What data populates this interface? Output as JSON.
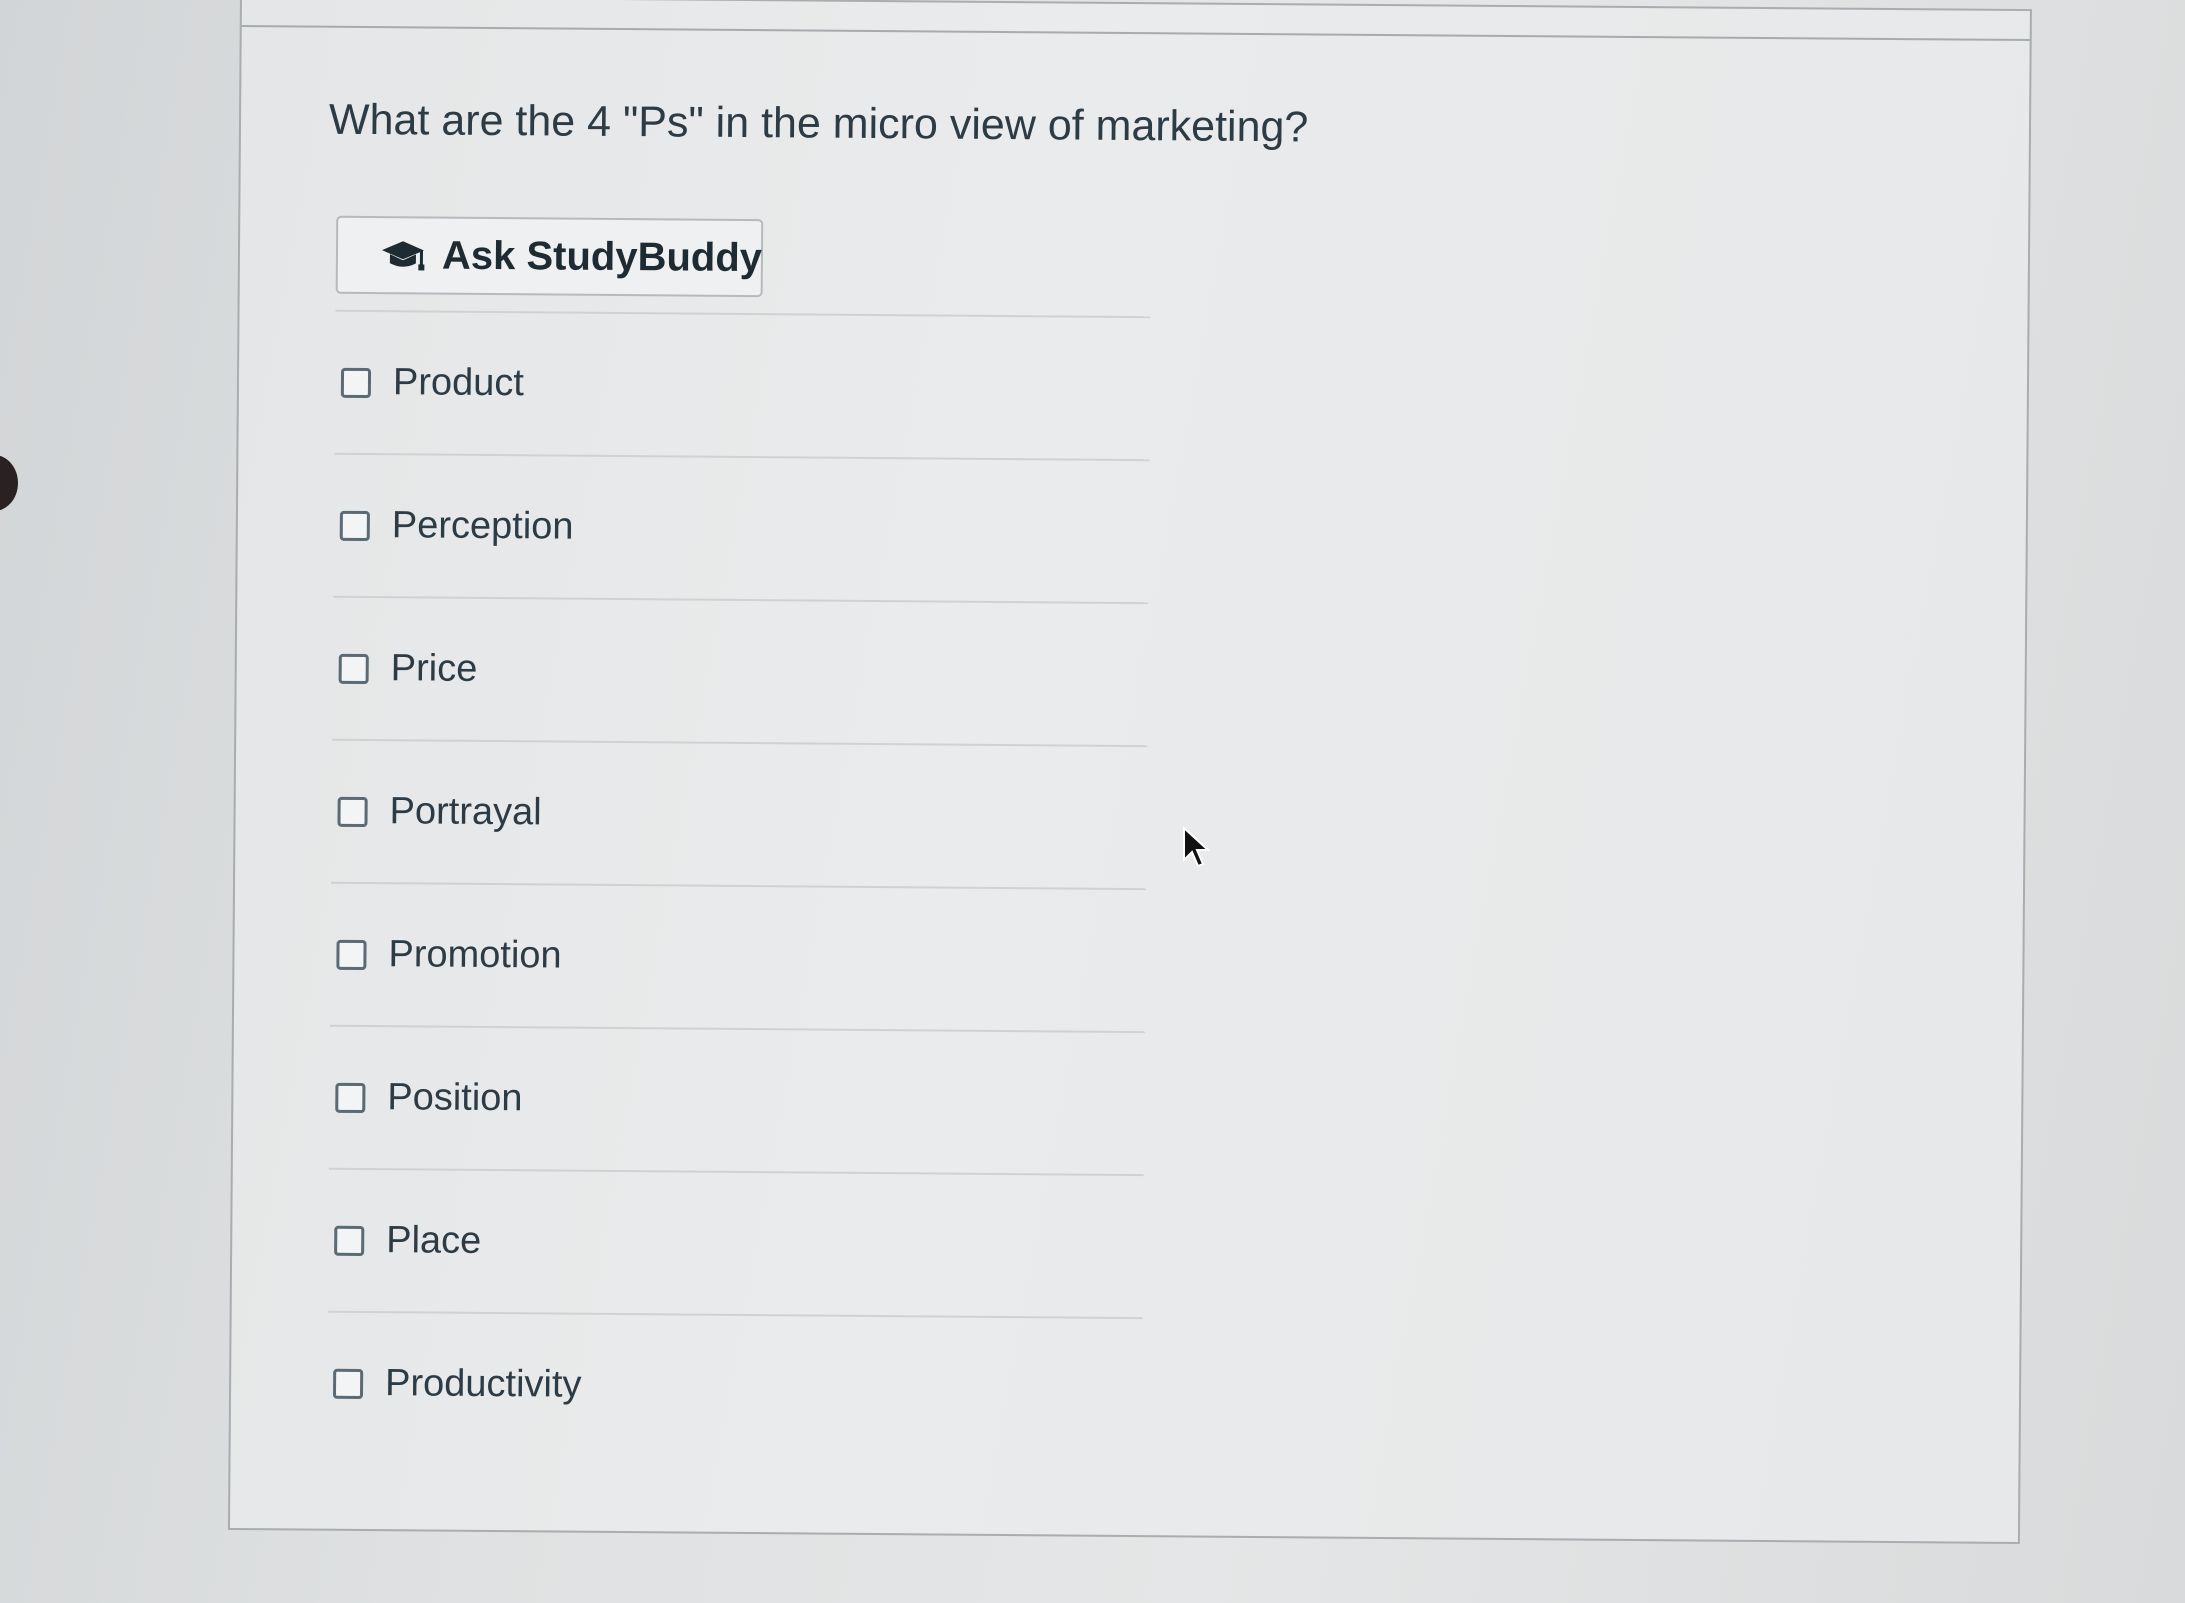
{
  "question": {
    "text": "What are the 4 \"Ps\" in the micro view of marketing?"
  },
  "study_buddy": {
    "label": "Ask StudyBuddy",
    "icon": "graduation-cap-icon"
  },
  "options": [
    {
      "label": "Product",
      "checked": false
    },
    {
      "label": "Perception",
      "checked": false
    },
    {
      "label": "Price",
      "checked": false
    },
    {
      "label": "Portrayal",
      "checked": false
    },
    {
      "label": "Promotion",
      "checked": false
    },
    {
      "label": "Position",
      "checked": false
    },
    {
      "label": "Place",
      "checked": false
    },
    {
      "label": "Productivity",
      "checked": false
    }
  ],
  "colors": {
    "text": "#2d3b45",
    "checkbox_border": "#5c6a73",
    "card_border": "#a9adb0"
  }
}
